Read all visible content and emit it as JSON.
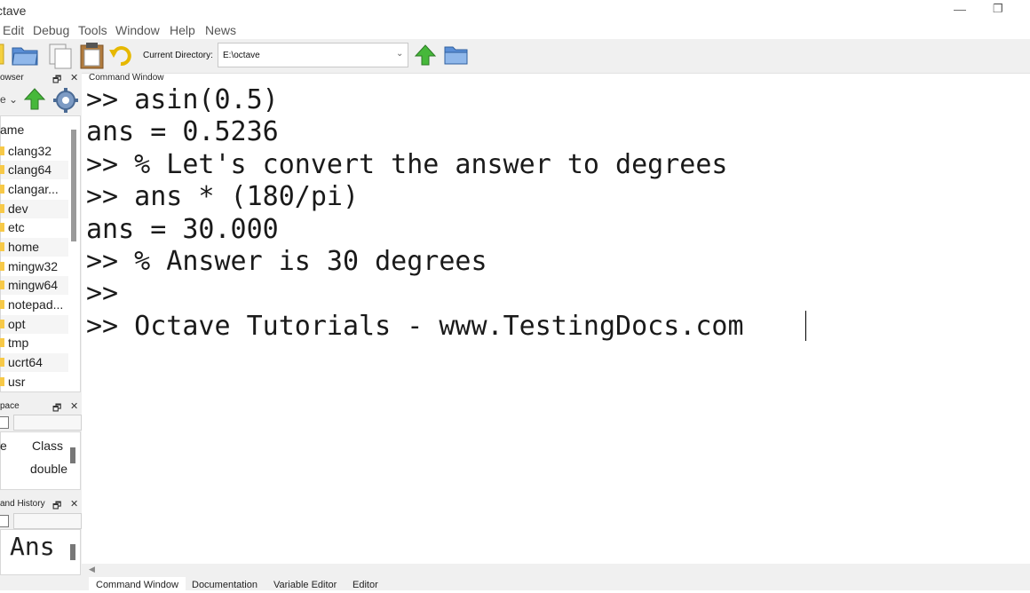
{
  "window": {
    "title": "ctave",
    "min_glyph": "—",
    "max_glyph": "❐"
  },
  "menu": [
    "Edit",
    "Debug",
    "Tools",
    "Window",
    "Help",
    "News"
  ],
  "toolbar": {
    "current_directory_label": "Current Directory:",
    "current_directory_value": "E:\\octave",
    "dropdown_glyph": "⌄"
  },
  "file_browser": {
    "title": "owser",
    "filter_glyph": "e ⌄",
    "column_header": "ame",
    "items": [
      "clang32",
      "clang64",
      "clangar...",
      "dev",
      "etc",
      "home",
      "mingw32",
      "mingw64",
      "notepad...",
      "opt",
      "tmp",
      "ucrt64",
      "usr"
    ]
  },
  "workspace": {
    "title": "pace",
    "col_name": "e",
    "col_class": "Class",
    "row_class": "double"
  },
  "history": {
    "title": "and History",
    "entry": "Ans"
  },
  "pane_buttons": {
    "float": "🗗",
    "close": "✕"
  },
  "command_window": {
    "title": "Command Window",
    "lines": [
      ">> asin(0.5)",
      "ans = 0.5236",
      ">> % Let's convert the answer to degrees",
      ">> ans * (180/pi)",
      "ans = 30.000",
      ">> % Answer is 30 degrees",
      ">>",
      ">> Octave Tutorials - www.TestingDocs.com"
    ]
  },
  "tabs": [
    "Command Window",
    "Documentation",
    "Variable Editor",
    "Editor"
  ]
}
